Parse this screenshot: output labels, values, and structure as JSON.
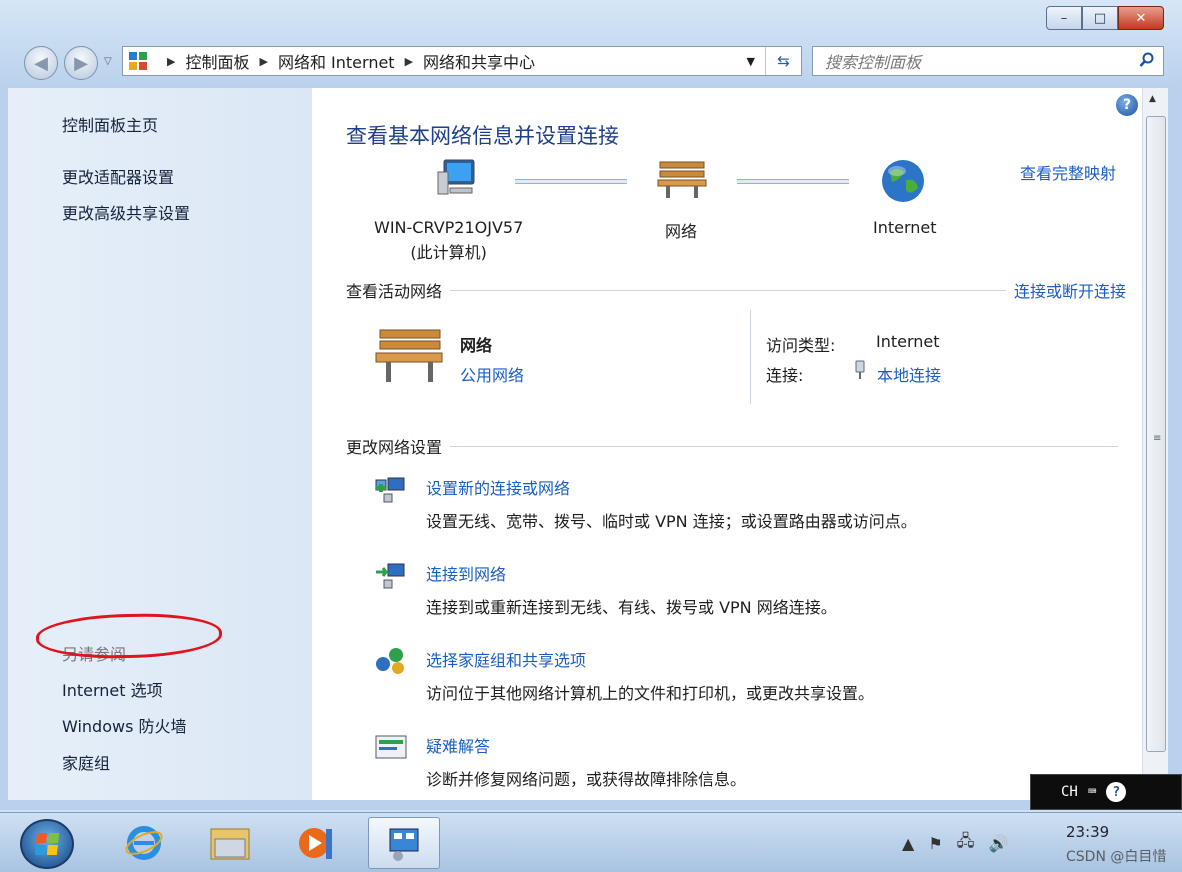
{
  "window": {
    "minimize": "–",
    "maximize": "□",
    "close": "✕"
  },
  "nav": {
    "breadcrumb": [
      "控制面板",
      "网络和 Internet",
      "网络和共享中心"
    ],
    "search_placeholder": "搜索控制面板"
  },
  "sidebar": {
    "home": "控制面板主页",
    "links": [
      "更改适配器设置",
      "更改高级共享设置"
    ],
    "see_also_heading": "另请参阅",
    "see_also": [
      "Internet 选项",
      "Windows 防火墙",
      "家庭组"
    ]
  },
  "main": {
    "title": "查看基本网络信息并设置连接",
    "view_full_map": "查看完整映射",
    "map": {
      "computer_name": "WIN-CRVP21OJV57",
      "computer_note": "(此计算机)",
      "network": "网络",
      "internet": "Internet"
    },
    "active_networks": {
      "heading": "查看活动网络",
      "action": "连接或断开连接",
      "network_name": "网络",
      "network_type": "公用网络",
      "access_type_label": "访问类型:",
      "access_type_value": "Internet",
      "connection_label": "连接:",
      "connection_value": "本地连接"
    },
    "change_settings": {
      "heading": "更改网络设置",
      "tasks": [
        {
          "link": "设置新的连接或网络",
          "desc": "设置无线、宽带、拨号、临时或 VPN 连接；或设置路由器或访问点。"
        },
        {
          "link": "连接到网络",
          "desc": "连接到或重新连接到无线、有线、拨号或 VPN 网络连接。"
        },
        {
          "link": "选择家庭组和共享选项",
          "desc": "访问位于其他网络计算机上的文件和打印机，或更改共享设置。"
        },
        {
          "link": "疑难解答",
          "desc": "诊断并修复网络问题，或获得故障排除信息。"
        }
      ]
    }
  },
  "langbar": {
    "lang": "CH",
    "help": "?"
  },
  "taskbar": {
    "time": "23:39",
    "watermark": "CSDN @白目惜"
  },
  "colors": {
    "link": "#1a5ec4",
    "title": "#1e3f8a",
    "highlight_ring": "#e0141e"
  }
}
